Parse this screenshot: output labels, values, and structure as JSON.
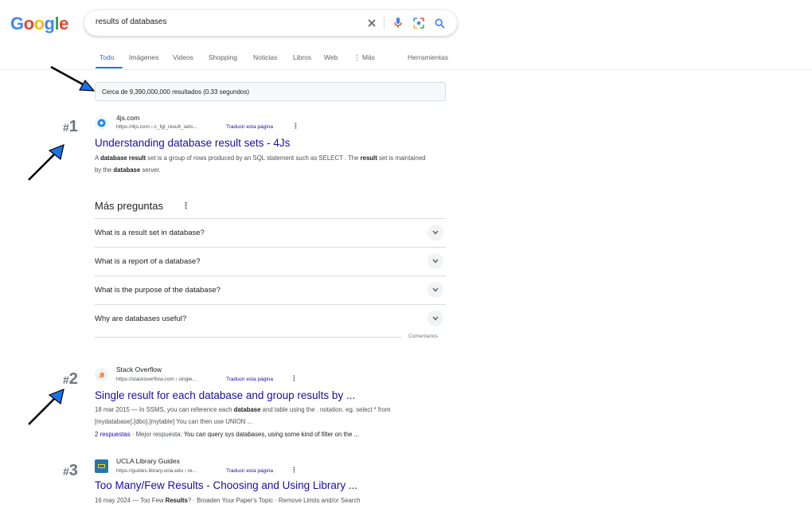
{
  "header": {
    "logo_letters": [
      "G",
      "o",
      "o",
      "g",
      "l",
      "e"
    ],
    "logo_colors": [
      "#4285F4",
      "#EA4335",
      "#FBBC05",
      "#4285F4",
      "#34A853",
      "#EA4335"
    ],
    "query": "results of databases",
    "icons": [
      "close-icon",
      "microphone-icon",
      "lens-icon",
      "search-icon"
    ]
  },
  "tabs": {
    "items": [
      "Todo",
      "Imágenes",
      "Videos",
      "Shopping",
      "Noticias",
      "Libros",
      "Web",
      "⋮ Más"
    ],
    "active": "Todo",
    "tools": "Herramientas"
  },
  "stats": "Cerca de 9,390,000,000 resultados (0.33 segundos)",
  "annotations": {
    "rank1": "1",
    "rank2": "2",
    "rank3": "3",
    "hash": "#",
    "arrow_color": "#1a73e8"
  },
  "results": [
    {
      "site": "4js.com",
      "url": "https://4js.com › c_fgl_result_sets...",
      "translate": "Traducir esta página",
      "title": "Understanding database result sets - 4Js",
      "snippet_parts": [
        {
          "t": "A ",
          "b": false
        },
        {
          "t": "database result",
          "b": true
        },
        {
          "t": " set is a group of rows produced by an SQL statement such as SELECT . The ",
          "b": false
        },
        {
          "t": "result",
          "b": true
        },
        {
          "t": " set is maintained by the ",
          "b": false
        },
        {
          "t": "database",
          "b": true
        },
        {
          "t": " server.",
          "b": false
        }
      ]
    },
    {
      "site": "Stack Overflow",
      "url": "https://stackoverflow.com › single...",
      "translate": "Traducir esta página",
      "title": "Single result for each database and group results by ...",
      "snippet_parts": [
        {
          "t": "18 mar 2015 — In SSMS, you can reference each ",
          "b": false
        },
        {
          "t": "database",
          "b": true
        },
        {
          "t": " and table using the . notation. eg. select * from [mydatabase].[dbo].[mytable] You can then use UNION ...",
          "b": false
        }
      ],
      "sublink": "2 respuestas",
      "sublink_rest": " · Mejor respuesta: ",
      "sublink_text": "You can query sys databases, using some kind of filter on the ..."
    },
    {
      "site": "UCLA Library Guides",
      "url": "https://guides.library.ucla.edu › re...",
      "translate": "Traducir esta página",
      "title": "Too Many/Few Results - Choosing and Using Library ...",
      "snippet_parts": [
        {
          "t": "16 may 2024 — Too Few ",
          "b": false
        },
        {
          "t": "Results",
          "b": true
        },
        {
          "t": "? · Broaden Your Paper's Topic · Remove Limits and/or Search",
          "b": false
        }
      ]
    }
  ],
  "paa": {
    "title": "Más preguntas",
    "questions": [
      "What is a result set in database?",
      "What is a report of a database?",
      "What is the purpose of the database?",
      "Why are databases useful?"
    ],
    "feedback": "Comentarios"
  }
}
